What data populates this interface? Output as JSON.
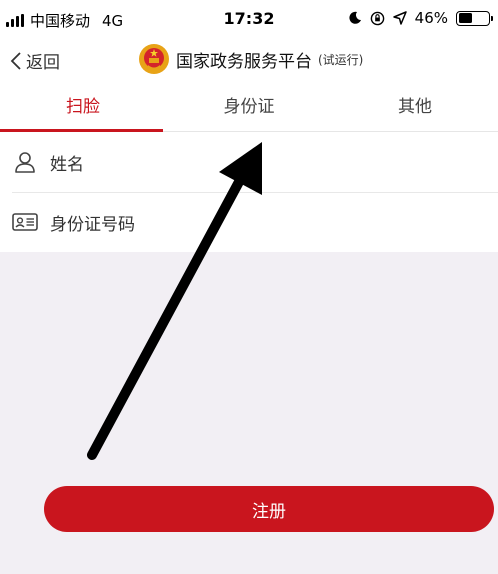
{
  "status_bar": {
    "carrier": "中国移动",
    "network": "4G",
    "time": "17:32",
    "battery": "46%",
    "battery_level": 0.46
  },
  "nav": {
    "back_label": "返回",
    "title": "国家政务服务平台",
    "title_suffix": "(试运行)"
  },
  "tabs": [
    {
      "label": "扫脸",
      "active": true
    },
    {
      "label": "身份证",
      "active": false
    },
    {
      "label": "其他",
      "active": false
    }
  ],
  "form": {
    "name_placeholder": "姓名",
    "id_placeholder": "身份证号码"
  },
  "register_label": "注册",
  "colors": {
    "accent": "#c9151e",
    "background": "#f2eff4"
  }
}
